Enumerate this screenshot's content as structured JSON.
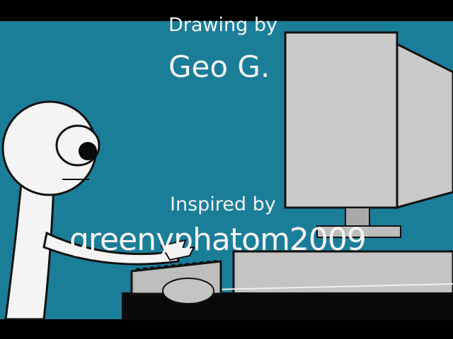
{
  "captions": {
    "drawing_label": "Drawing by",
    "author": "Geo G.",
    "inspired_label": "Inspired by",
    "inspired_handle": "greenyphatom2009"
  },
  "colors": {
    "background": "#1b7e99",
    "letterbox": "#000000",
    "monitor": "#c9c9c9",
    "monitor_outline": "#111111",
    "figure": "#f4f4f4",
    "desk": "#0a0a0a",
    "text": "#f2f2f2"
  },
  "icons": {
    "character": "stick-figure-icon",
    "monitor": "computer-monitor-icon",
    "keyboard": "keyboard-icon",
    "mouse": "mouse-icon"
  }
}
